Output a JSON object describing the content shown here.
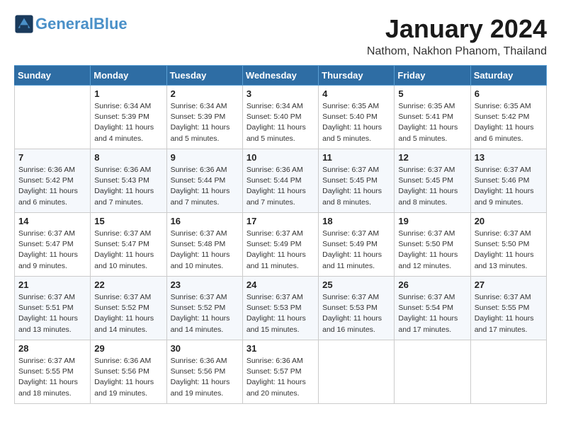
{
  "header": {
    "logo_line1": "General",
    "logo_line2": "Blue",
    "month": "January 2024",
    "location": "Nathom, Nakhon Phanom, Thailand"
  },
  "weekdays": [
    "Sunday",
    "Monday",
    "Tuesday",
    "Wednesday",
    "Thursday",
    "Friday",
    "Saturday"
  ],
  "weeks": [
    [
      {
        "day": "",
        "info": ""
      },
      {
        "day": "1",
        "info": "Sunrise: 6:34 AM\nSunset: 5:39 PM\nDaylight: 11 hours\nand 4 minutes."
      },
      {
        "day": "2",
        "info": "Sunrise: 6:34 AM\nSunset: 5:39 PM\nDaylight: 11 hours\nand 5 minutes."
      },
      {
        "day": "3",
        "info": "Sunrise: 6:34 AM\nSunset: 5:40 PM\nDaylight: 11 hours\nand 5 minutes."
      },
      {
        "day": "4",
        "info": "Sunrise: 6:35 AM\nSunset: 5:40 PM\nDaylight: 11 hours\nand 5 minutes."
      },
      {
        "day": "5",
        "info": "Sunrise: 6:35 AM\nSunset: 5:41 PM\nDaylight: 11 hours\nand 5 minutes."
      },
      {
        "day": "6",
        "info": "Sunrise: 6:35 AM\nSunset: 5:42 PM\nDaylight: 11 hours\nand 6 minutes."
      }
    ],
    [
      {
        "day": "7",
        "info": "Sunrise: 6:36 AM\nSunset: 5:42 PM\nDaylight: 11 hours\nand 6 minutes."
      },
      {
        "day": "8",
        "info": "Sunrise: 6:36 AM\nSunset: 5:43 PM\nDaylight: 11 hours\nand 7 minutes."
      },
      {
        "day": "9",
        "info": "Sunrise: 6:36 AM\nSunset: 5:44 PM\nDaylight: 11 hours\nand 7 minutes."
      },
      {
        "day": "10",
        "info": "Sunrise: 6:36 AM\nSunset: 5:44 PM\nDaylight: 11 hours\nand 7 minutes."
      },
      {
        "day": "11",
        "info": "Sunrise: 6:37 AM\nSunset: 5:45 PM\nDaylight: 11 hours\nand 8 minutes."
      },
      {
        "day": "12",
        "info": "Sunrise: 6:37 AM\nSunset: 5:45 PM\nDaylight: 11 hours\nand 8 minutes."
      },
      {
        "day": "13",
        "info": "Sunrise: 6:37 AM\nSunset: 5:46 PM\nDaylight: 11 hours\nand 9 minutes."
      }
    ],
    [
      {
        "day": "14",
        "info": "Sunrise: 6:37 AM\nSunset: 5:47 PM\nDaylight: 11 hours\nand 9 minutes."
      },
      {
        "day": "15",
        "info": "Sunrise: 6:37 AM\nSunset: 5:47 PM\nDaylight: 11 hours\nand 10 minutes."
      },
      {
        "day": "16",
        "info": "Sunrise: 6:37 AM\nSunset: 5:48 PM\nDaylight: 11 hours\nand 10 minutes."
      },
      {
        "day": "17",
        "info": "Sunrise: 6:37 AM\nSunset: 5:49 PM\nDaylight: 11 hours\nand 11 minutes."
      },
      {
        "day": "18",
        "info": "Sunrise: 6:37 AM\nSunset: 5:49 PM\nDaylight: 11 hours\nand 11 minutes."
      },
      {
        "day": "19",
        "info": "Sunrise: 6:37 AM\nSunset: 5:50 PM\nDaylight: 11 hours\nand 12 minutes."
      },
      {
        "day": "20",
        "info": "Sunrise: 6:37 AM\nSunset: 5:50 PM\nDaylight: 11 hours\nand 13 minutes."
      }
    ],
    [
      {
        "day": "21",
        "info": "Sunrise: 6:37 AM\nSunset: 5:51 PM\nDaylight: 11 hours\nand 13 minutes."
      },
      {
        "day": "22",
        "info": "Sunrise: 6:37 AM\nSunset: 5:52 PM\nDaylight: 11 hours\nand 14 minutes."
      },
      {
        "day": "23",
        "info": "Sunrise: 6:37 AM\nSunset: 5:52 PM\nDaylight: 11 hours\nand 14 minutes."
      },
      {
        "day": "24",
        "info": "Sunrise: 6:37 AM\nSunset: 5:53 PM\nDaylight: 11 hours\nand 15 minutes."
      },
      {
        "day": "25",
        "info": "Sunrise: 6:37 AM\nSunset: 5:53 PM\nDaylight: 11 hours\nand 16 minutes."
      },
      {
        "day": "26",
        "info": "Sunrise: 6:37 AM\nSunset: 5:54 PM\nDaylight: 11 hours\nand 17 minutes."
      },
      {
        "day": "27",
        "info": "Sunrise: 6:37 AM\nSunset: 5:55 PM\nDaylight: 11 hours\nand 17 minutes."
      }
    ],
    [
      {
        "day": "28",
        "info": "Sunrise: 6:37 AM\nSunset: 5:55 PM\nDaylight: 11 hours\nand 18 minutes."
      },
      {
        "day": "29",
        "info": "Sunrise: 6:36 AM\nSunset: 5:56 PM\nDaylight: 11 hours\nand 19 minutes."
      },
      {
        "day": "30",
        "info": "Sunrise: 6:36 AM\nSunset: 5:56 PM\nDaylight: 11 hours\nand 19 minutes."
      },
      {
        "day": "31",
        "info": "Sunrise: 6:36 AM\nSunset: 5:57 PM\nDaylight: 11 hours\nand 20 minutes."
      },
      {
        "day": "",
        "info": ""
      },
      {
        "day": "",
        "info": ""
      },
      {
        "day": "",
        "info": ""
      }
    ]
  ]
}
